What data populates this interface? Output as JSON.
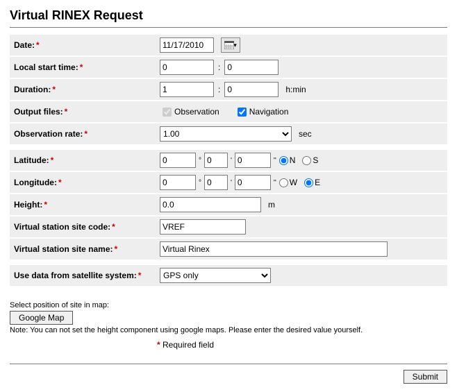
{
  "title": "Virtual RINEX Request",
  "labels": {
    "date": "Date:",
    "local_start": "Local start time:",
    "duration": "Duration:",
    "output_files": "Output files:",
    "obs_rate": "Observation rate:",
    "latitude": "Latitude:",
    "longitude": "Longitude:",
    "height": "Height:",
    "site_code": "Virtual station site code:",
    "site_name": "Virtual station site name:",
    "sat_system": "Use data from satellite system:",
    "map_prompt": "Select position of site in map:",
    "map_btn": "Google Map",
    "map_note": "Note: You can not set the height component using google maps. Please enter the desired value yourself.",
    "required": "Required field",
    "submit": "Submit"
  },
  "units": {
    "hmin": "h:min",
    "sec": "sec",
    "m": "m",
    "deg": "°",
    "min": "'",
    "sec_arc": "''"
  },
  "values": {
    "date": "11/17/2010",
    "start_h": "0",
    "start_m": "0",
    "dur_h": "1",
    "dur_m": "0",
    "obs_checked": true,
    "nav_checked": true,
    "obs_label": "Observation",
    "nav_label": "Navigation",
    "obs_rate": "1.00",
    "lat_d": "0",
    "lat_m": "0",
    "lat_s": "0",
    "lon_d": "0",
    "lon_m": "0",
    "lon_s": "0",
    "lat_dir": "N",
    "lon_dir": "E",
    "lat_n": "N",
    "lat_s_lbl": "S",
    "lon_w": "W",
    "lon_e": "E",
    "height": "0.0",
    "site_code": "VREF",
    "site_name": "Virtual Rinex",
    "sat_system": "GPS only"
  }
}
